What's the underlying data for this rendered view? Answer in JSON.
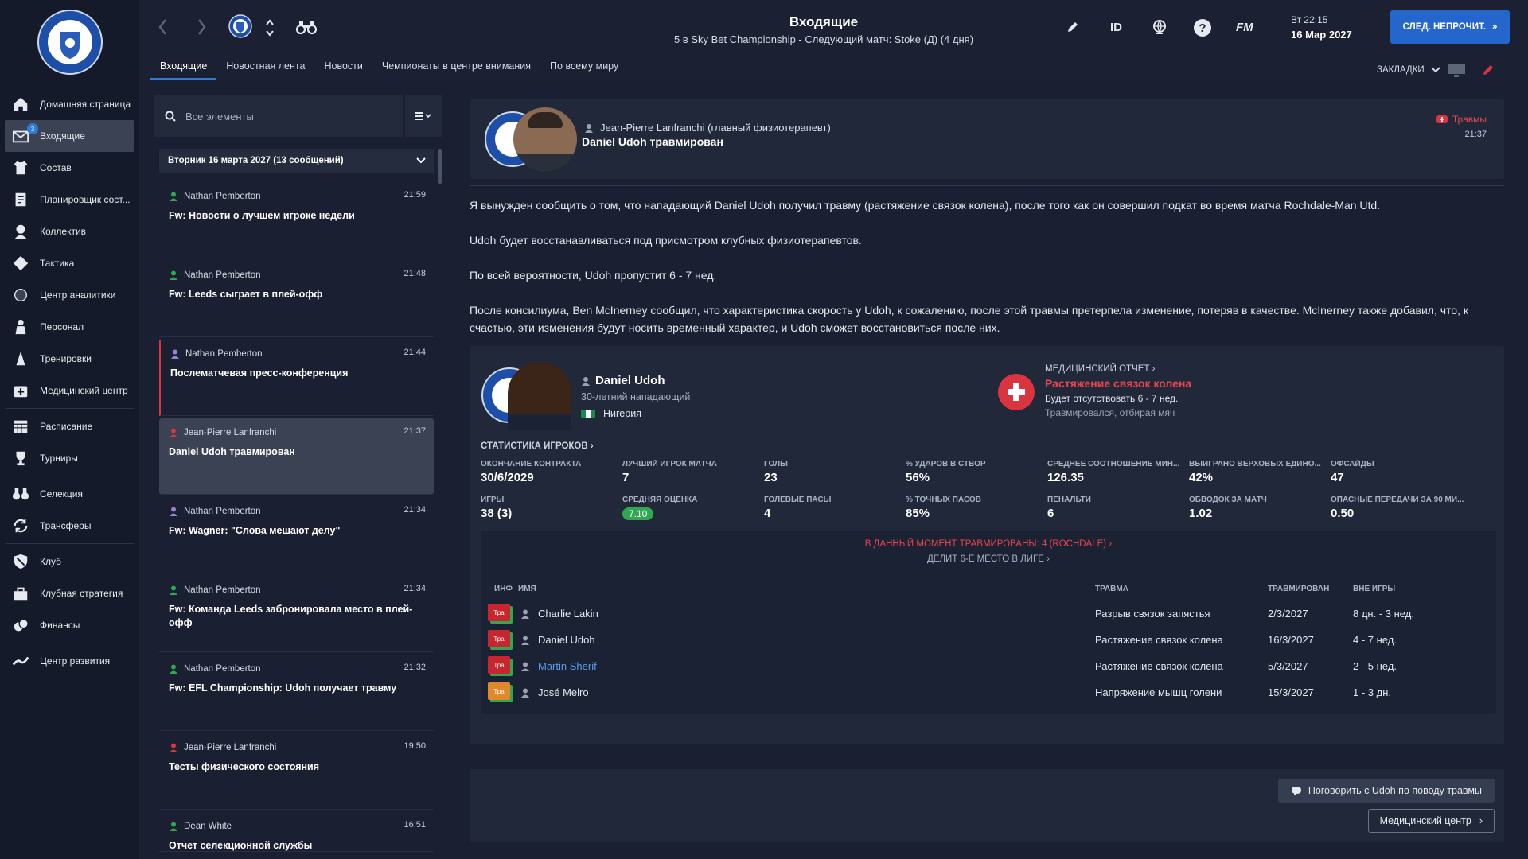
{
  "sidebar": {
    "inbox_badge": "3",
    "items": [
      {
        "label": "Домашняя страница",
        "icon": "home-icon"
      },
      {
        "label": "Входящие",
        "icon": "inbox-icon"
      },
      {
        "label": "Состав",
        "icon": "shirt-icon"
      },
      {
        "label": "Планировщик сост...",
        "icon": "planner-icon"
      },
      {
        "label": "Коллектив",
        "icon": "team-icon"
      },
      {
        "label": "Тактика",
        "icon": "tactics-icon"
      },
      {
        "label": "Центр аналитики",
        "icon": "analytics-icon"
      },
      {
        "label": "Персонал",
        "icon": "staff-icon"
      },
      {
        "label": "Тренировки",
        "icon": "training-icon"
      },
      {
        "label": "Медицинский центр",
        "icon": "medical-icon"
      },
      {
        "label": "Расписание",
        "icon": "calendar-icon"
      },
      {
        "label": "Турниры",
        "icon": "trophy-icon"
      },
      {
        "label": "Селекция",
        "icon": "binoculars-icon"
      },
      {
        "label": "Трансферы",
        "icon": "transfer-icon"
      },
      {
        "label": "Клуб",
        "icon": "shield-icon"
      },
      {
        "label": "Клубная стратегия",
        "icon": "strategy-icon"
      },
      {
        "label": "Финансы",
        "icon": "finance-icon"
      },
      {
        "label": "Центр развития",
        "icon": "development-icon"
      }
    ]
  },
  "header": {
    "title": "Входящие",
    "subtitle": "5 в Sky Bet Championship - Следующий матч: Stoke (Д) (4 дня)",
    "tabs": [
      "Входящие",
      "Новостная лента",
      "Новости",
      "Чемпионаты в центре внимания",
      "По всему миру"
    ],
    "id_label": "ID",
    "fm_label": "FM",
    "day_time": "Вт 22:15",
    "date": "16 Мар 2027",
    "next_button": "СЛЕД. НЕПРОЧИТ.",
    "bookmarks": "ЗАКЛАДКИ"
  },
  "inbox": {
    "search_placeholder": "Все элементы",
    "group_header": "Вторник 16 марта 2027 (13 сообщений)",
    "messages": [
      {
        "from": "Nathan Pemberton",
        "time": "21:59",
        "subject": "Fw: Новости о лучшем игроке недели"
      },
      {
        "from": "Nathan Pemberton",
        "time": "21:48",
        "subject": "Fw: Leeds сыграет в плей-офф"
      },
      {
        "from": "Nathan Pemberton",
        "time": "21:44",
        "subject": "Послематчевая пресс-конференция"
      },
      {
        "from": "Jean-Pierre Lanfranchi",
        "time": "21:37",
        "subject": "Daniel Udoh травмирован"
      },
      {
        "from": "Nathan Pemberton",
        "time": "21:34",
        "subject": "Fw: Wagner: \"Слова мешают делу\""
      },
      {
        "from": "Nathan Pemberton",
        "time": "21:34",
        "subject": "Fw: Команда Leeds забронировала место в плей-офф"
      },
      {
        "from": "Nathan Pemberton",
        "time": "21:32",
        "subject": "Fw: EFL Championship: Udoh получает травму"
      },
      {
        "from": "Jean-Pierre Lanfranchi",
        "time": "19:50",
        "subject": "Тесты физического состояния"
      },
      {
        "from": "Dean White",
        "time": "16:51",
        "subject": "Отчет селекционной службы"
      }
    ]
  },
  "message": {
    "sender": "Jean-Pierre Lanfranchi  (главный физиотерапевт)",
    "title": "Daniel Udoh травмирован",
    "tag": "Травмы",
    "time": "21:37",
    "paragraphs": [
      "Я вынужден сообщить о том, что нападающий Daniel Udoh получил травму (растяжение связок колена), после того как он совершил подкат во время матча Rochdale-Man Utd.",
      "Udoh будет восстанавливаться под присмотром клубных физиотерапевтов.",
      "По всей вероятности, Udoh пропустит 6 - 7 нед.",
      "После консилиума, Ben McInerney сообщил, что характеристика скорость у Udoh, к сожалению, после этой травмы претерпела изменение, потеряв в качестве. McInerney также добавил, что, к счастью, эти изменения будут носить временный характер, и Udoh сможет восстановиться после них."
    ]
  },
  "player": {
    "name": "Daniel Udoh",
    "desc": "30-летний нападающий",
    "nation": "Нигерия",
    "medical_title": "МЕДИЦИНСКИЙ ОТЧЕТ",
    "injury": "Растяжение связок колена",
    "out": "Будет отсутствовать 6 - 7 нед.",
    "cause": "Травмировался, отбирая мяч",
    "stats_title": "СТАТИСТИКА ИГРОКОВ",
    "stats_row1": [
      {
        "label": "ОКОНЧАНИЕ КОНТРАКТА",
        "value": "30/6/2029"
      },
      {
        "label": "ЛУЧШИЙ ИГРОК МАТЧА",
        "value": "7"
      },
      {
        "label": "ГОЛЫ",
        "value": "23"
      },
      {
        "label": "% УДАРОВ В СТВОР",
        "value": "56%"
      },
      {
        "label": "СРЕДНЕЕ СООТНОШЕНИЕ МИН...",
        "value": "126.35"
      },
      {
        "label": "ВЫИГРАНО ВЕРХОВЫХ ЕДИНО...",
        "value": "42%"
      },
      {
        "label": "ОФСАЙДЫ",
        "value": "47"
      }
    ],
    "stats_row2": [
      {
        "label": "ИГРЫ",
        "value": "38 (3)"
      },
      {
        "label": "СРЕДНЯЯ ОЦЕНКА",
        "value": "7.10"
      },
      {
        "label": "ГОЛЕВЫЕ ПАСЫ",
        "value": "4"
      },
      {
        "label": "% ТОЧНЫХ ПАСОВ",
        "value": "85%"
      },
      {
        "label": "ПЕНАЛЬТИ",
        "value": "6"
      },
      {
        "label": "ОБВОДОК ЗА МАТЧ",
        "value": "1.02"
      },
      {
        "label": "ОПАСНЫЕ ПЕРЕДАЧИ ЗА 90 МИ...",
        "value": "0.50"
      }
    ]
  },
  "injuries": {
    "now": "В ДАННЫЙ МОМЕНТ ТРАВМИРОВАНЫ: 4 (ROCHDALE)",
    "rank": "ДЕЛИТ 6-Е МЕСТО В ЛИГЕ",
    "headers": {
      "info": "ИНФ",
      "name": "ИМЯ",
      "injury": "ТРАВМА",
      "date": "ТРАВМИРОВАН",
      "out": "ВНЕ ИГРЫ"
    },
    "badge_label": "Тра",
    "rows": [
      {
        "name": "Charlie Lakin",
        "injury": "Разрыв связок запястья",
        "date": "2/3/2027",
        "out": "8 дн. - 3 нед.",
        "color": "#c8262f",
        "link": false
      },
      {
        "name": "Daniel Udoh",
        "injury": "Растяжение связок колена",
        "date": "16/3/2027",
        "out": "4 - 7 нед.",
        "color": "#c8262f",
        "link": false
      },
      {
        "name": "Martin Sherif",
        "injury": "Растяжение связок колена",
        "date": "5/3/2027",
        "out": "2 - 5 нед.",
        "color": "#c8262f",
        "link": true
      },
      {
        "name": "José Melro",
        "injury": "Напряжение мышц голени",
        "date": "15/3/2027",
        "out": "1 - 3 дн.",
        "color": "#e0892a",
        "link": false
      }
    ]
  },
  "actions": {
    "talk": "Поговорить с Udoh по поводу травмы",
    "medical": "Медицинский центр"
  },
  "colors": {
    "accent": "#2466cc",
    "injury_red": "#e8454f",
    "rating_green": "#2fa84f"
  }
}
